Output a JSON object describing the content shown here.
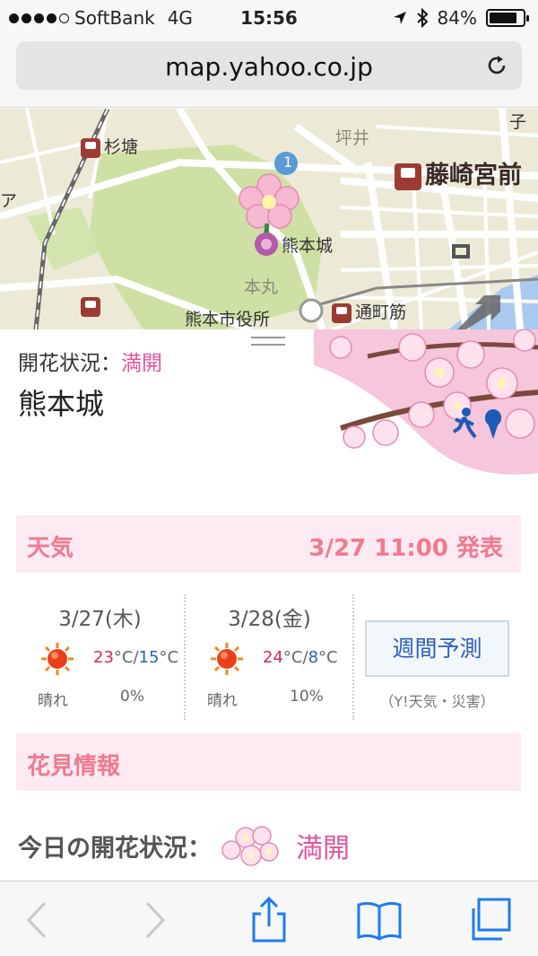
{
  "status_bar": {
    "carrier": "SoftBank",
    "network": "4G",
    "time": "15:56",
    "battery_text": "84%",
    "battery_level": 0.84,
    "icons": [
      "location-arrow-icon",
      "bluetooth-icon",
      "battery-icon"
    ]
  },
  "browser": {
    "url": "map.yahoo.co.jp"
  },
  "map": {
    "labels": {
      "sugido": "杉塘",
      "tsuboi": "坪井",
      "fujisakigu": "藤崎宮前",
      "kumamotojo": "熊本城",
      "honmaru": "本丸",
      "city_hall": "熊本市役所",
      "toricho": "通町筋",
      "kodomo_partial": "子",
      "a_partial": "ア",
      "route_number": "1"
    }
  },
  "info": {
    "bloom_label": "開花状況：",
    "bloom_status": "満開",
    "place_name": "熊本城"
  },
  "weather": {
    "title": "天気",
    "issued": "3/27 11:00 発表",
    "days": [
      {
        "date": "3/27(木)",
        "hi": "23",
        "lo": "15",
        "unit": "°C",
        "slash": "/",
        "condition": "晴れ",
        "rain": "0%"
      },
      {
        "date": "3/28(金)",
        "hi": "24",
        "lo": "8",
        "unit": "°C",
        "slash": "/",
        "condition": "晴れ",
        "rain": "10%"
      }
    ],
    "weekly_button": "週間予測",
    "source": "（Y!天気・災害）"
  },
  "hanami": {
    "title": "花見情報",
    "today_label": "今日の開花状況：",
    "today_status": "満開"
  },
  "toolbar": {
    "icons": [
      "back-icon",
      "forward-icon",
      "share-icon",
      "bookmarks-icon",
      "tabs-icon"
    ]
  },
  "colors": {
    "pink_text": "#e0569c",
    "section_bg": "#fdeaf3",
    "section_title": "#f07a8e",
    "link_blue": "#2f5fb9",
    "temp_hi": "#d12b5a",
    "ios_blue": "#1d7bf2"
  }
}
